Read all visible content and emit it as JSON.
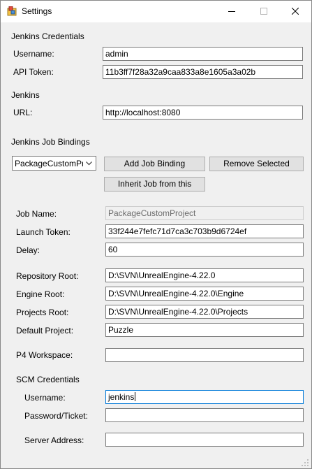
{
  "window": {
    "title": "Settings"
  },
  "jenkins_credentials": {
    "heading": "Jenkins Credentials",
    "username_label": "Username:",
    "username_value": "admin",
    "api_token_label": "API Token:",
    "api_token_value": "11b3ff7f28a32a9caa833a8e1605a3a02b"
  },
  "jenkins": {
    "heading": "Jenkins",
    "url_label": "URL:",
    "url_value": "http://localhost:8080"
  },
  "job_bindings": {
    "heading": "Jenkins Job Bindings",
    "selected_job": "PackageCustomProject",
    "add_label": "Add Job Binding",
    "remove_label": "Remove Selected",
    "inherit_label": "Inherit Job from this"
  },
  "job": {
    "name_label": "Job Name:",
    "name_value": "PackageCustomProject",
    "launch_token_label": "Launch Token:",
    "launch_token_value": "33f244e7fefc71d7ca3c703b9d6724ef",
    "delay_label": "Delay:",
    "delay_value": "60",
    "repo_root_label": "Repository Root:",
    "repo_root_value": "D:\\SVN\\UnrealEngine-4.22.0",
    "engine_root_label": "Engine Root:",
    "engine_root_value": "D:\\SVN\\UnrealEngine-4.22.0\\Engine",
    "projects_root_label": "Projects Root:",
    "projects_root_value": "D:\\SVN\\UnrealEngine-4.22.0\\Projects",
    "default_project_label": "Default Project:",
    "default_project_value": "Puzzle",
    "p4_workspace_label": "P4 Workspace:",
    "p4_workspace_value": ""
  },
  "scm": {
    "heading": "SCM Credentials",
    "username_label": "Username:",
    "username_value": "jenkins",
    "password_label": "Password/Ticket:",
    "password_value": "",
    "server_label": "Server Address:",
    "server_value": ""
  },
  "colors": {
    "accent": "#0078d7",
    "window_bg": "#f0f0f0",
    "titlebar_bg": "#ffffff"
  }
}
